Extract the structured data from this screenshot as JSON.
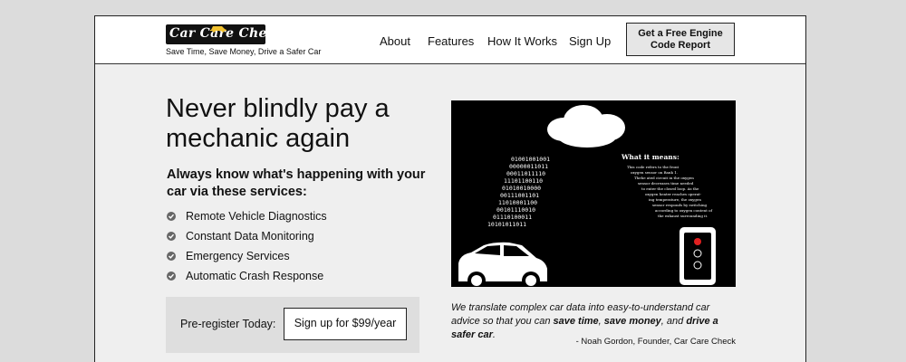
{
  "header": {
    "logo_text": "Car Care Check",
    "tagline": "Save Time, Save Money, Drive a Safer Car",
    "nav": [
      "About",
      "Features",
      "How It Works",
      "Sign Up"
    ],
    "cta_line1": "Get a Free Engine",
    "cta_line2": "Code Report"
  },
  "hero": {
    "headline_line1": "Never blindly pay a",
    "headline_line2": "mechanic again",
    "subhead": "Always know what's happening with your car via these services:",
    "services": [
      "Remote Vehicle Diagnostics",
      "Constant Data Monitoring",
      "Emergency Services",
      "Automatic Crash Response"
    ]
  },
  "preregister": {
    "label": "Pre-register Today:",
    "button": "Sign up for $99/year"
  },
  "illustration": {
    "binary": [
      "01001001001",
      "00000011011",
      "00011011110",
      "11101100110",
      "01010010000",
      "00111001101",
      "11010001100",
      "00101110010",
      "01110100011",
      "10101011011"
    ],
    "meaning_title": "What it means:",
    "meaning_lines": [
      "This code refers to the front",
      "oxygen sensor on Bank 1.",
      "Thehe ated circuit in the oxygen",
      "sensor decreases time needed",
      "to enter the closed loop. As the",
      "oxygen heater reaches operat-",
      "ing temperature, the oxygen",
      "sensor responds by switching",
      "according to oxygen content of",
      "the exhaust surrounding it."
    ]
  },
  "quote": {
    "prefix": "We translate complex car data into easy-to-understand car advice so that you can ",
    "em1": "save time",
    "sep1": ", ",
    "em2": "save money",
    "sep2": ", and ",
    "em3": "drive a safer car",
    "suffix": ".",
    "attribution": "- Noah Gordon, Founder, Car Care Check"
  },
  "colors": {
    "logo_car": "#f2c230",
    "illustration_bg": "#000000"
  }
}
